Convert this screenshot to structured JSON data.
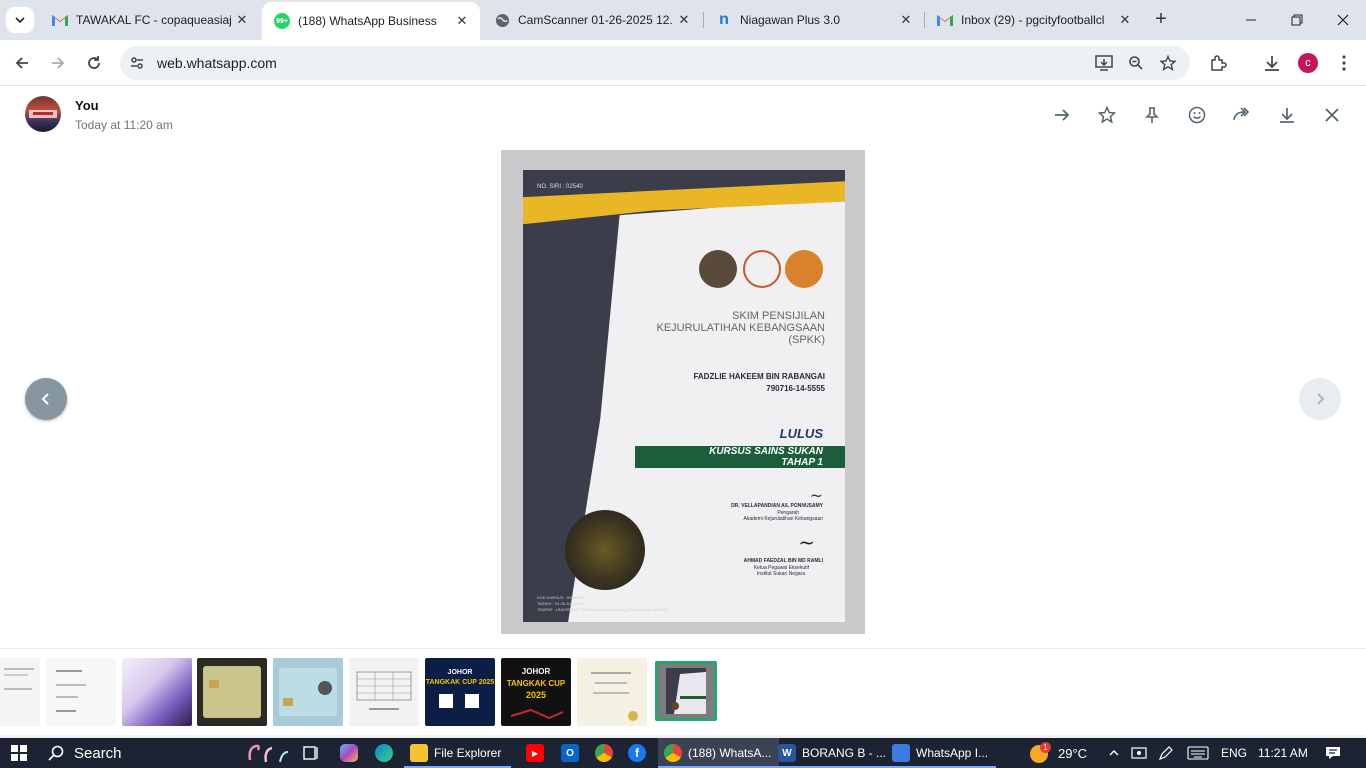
{
  "browser": {
    "tabs": [
      {
        "title": "TAWAKAL FC - copaqueasiaj",
        "favicon": "gmail-icon"
      },
      {
        "title": "(188) WhatsApp Business",
        "favicon": "whatsapp-icon",
        "badge": "99+"
      },
      {
        "title": "CamScanner 01-26-2025 12.",
        "favicon": "globe-icon"
      },
      {
        "title": "Niagawan Plus 3.0",
        "favicon": "niagawan-icon",
        "favicon_letter": "n"
      },
      {
        "title": "Inbox (29) - pgcityfootballcl",
        "favicon": "gmail-icon"
      }
    ],
    "url": "web.whatsapp.com",
    "profile_initial": "c"
  },
  "viewer": {
    "sender": "You",
    "timestamp": "Today at 11:20 am",
    "actions": [
      "go-to-message-icon",
      "star-icon",
      "pin-icon",
      "react-icon",
      "forward-icon",
      "download-icon",
      "close-icon"
    ]
  },
  "certificate": {
    "serial": "NO. SIRI : 02540",
    "scheme_line1": "SKIM PENSIJILAN",
    "scheme_line2": "KEJURULATIHAN KEBANGSAAN",
    "scheme_abbr": "(SPKK)",
    "holder_name": "FADZLIE HAKEEM BIN RABANGAI",
    "holder_id": "790716-14-5555",
    "result": "LULUS",
    "course_line1": "KURSUS SAINS SUKAN",
    "course_line2": "TAHAP 1",
    "signatory1_name": "DR. VELLAPANDIAN A/L PONNUSAMY",
    "signatory1_title1": "Pengarah",
    "signatory1_title2": "Akademi Kejurulatihan Kebangsaan",
    "signatory2_name": "AHMAD FAEDZAL BIN MD RAMLI",
    "signatory2_title1": "Ketua Pegawai Eksekutif",
    "signatory2_title2": "Institut Sukan Negara",
    "footer_line1": "KOD KURSUS : 0/09/2019",
    "footer_line2": "TARIKH     : 24-26 JUN 2019",
    "footer_line3": "TEMPAT     : UNIVERSITI TEKNOLOGI MALAYSIA (UTM) SKUDAI, JOHOR"
  },
  "thumbnails": {
    "count": 10,
    "selected_index": 9,
    "labels": [
      "JOHOR",
      "TANGKAK CUP 2025",
      "JOHOR",
      "TANGKAK CUP",
      "2025"
    ]
  },
  "taskbar": {
    "search_label": "Search",
    "apps": [
      {
        "label": "File Explorer",
        "icon": "folder-icon"
      },
      {
        "label": "(188) WhatsA...",
        "icon": "chrome-icon"
      },
      {
        "label": "BORANG B - ...",
        "icon": "word-icon"
      },
      {
        "label": "WhatsApp I...",
        "icon": "paint-icon"
      }
    ],
    "weather": "29°C",
    "weather_badge": "1",
    "language": "ENG",
    "time": "11:21 AM"
  }
}
